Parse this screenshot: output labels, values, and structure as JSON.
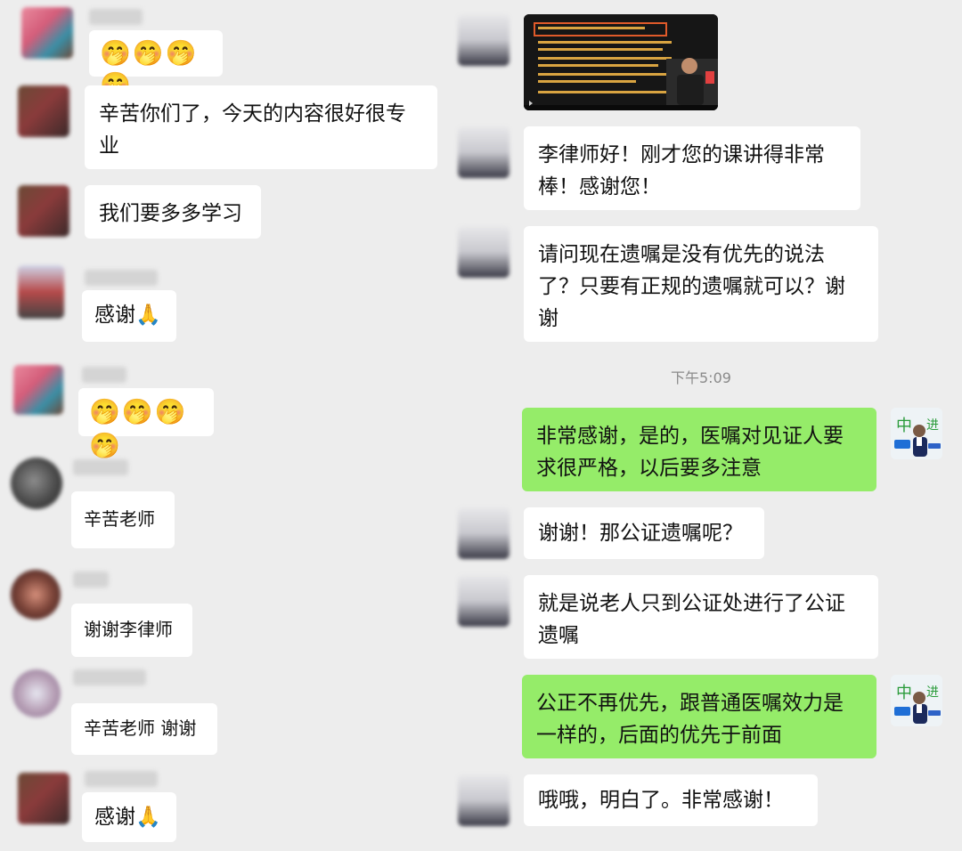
{
  "left_chat": {
    "msg1_emoji": "🤭🤭🤭🤭",
    "msg2_text": "辛苦你们了，今天的内容很好很专业",
    "msg3_text": "我们要多多学习",
    "msg4_text": "感谢🙏",
    "msg5_emoji": "🤭🤭🤭🤭",
    "msg6_text": "辛苦老师",
    "msg7_text": "谢谢李律师",
    "msg8_text": "辛苦老师 谢谢",
    "msg9_text": "感谢🙏"
  },
  "right_chat": {
    "msg1_text": "李律师好！刚才您的课讲得非常棒！感谢您！",
    "msg2_text": "请问现在遗嘱是没有优先的说法了？只要有正规的遗嘱就可以？谢谢",
    "timestamp": "下午5:09",
    "reply1_text": "非常感谢，是的，医嘱对见证人要求很严格，以后要多注意",
    "msg3_text": "谢谢！那公证遗嘱呢？",
    "msg4_text": "就是说老人只到公证处进行了公证遗嘱",
    "reply2_text": "公正不再优先，跟普通医嘱效力是一样的，后面的优先于前面",
    "msg5_text": "哦哦，明白了。非常感谢！"
  },
  "colors": {
    "background": "#ededed",
    "bubble": "#ffffff",
    "self_bubble": "#95ec69"
  }
}
